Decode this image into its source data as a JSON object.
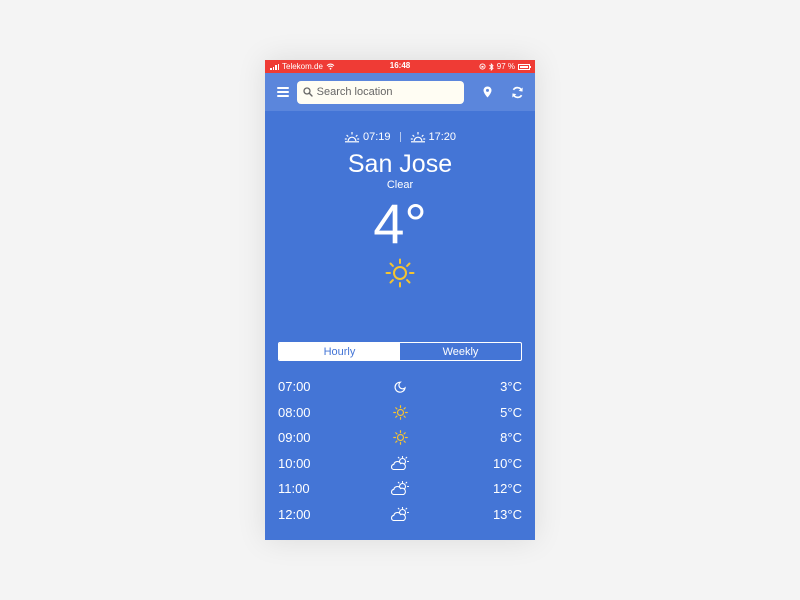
{
  "status_bar": {
    "carrier": "Telekom.de",
    "time": "16:48",
    "battery": "97 %",
    "battery_level": 0.97
  },
  "search": {
    "placeholder": "Search location"
  },
  "weather": {
    "sunrise": "07:19",
    "sunset": "17:20",
    "city": "San Jose",
    "condition": "Clear",
    "temperature": "4°",
    "icon": "sun-icon"
  },
  "tabs": [
    {
      "label": "Hourly",
      "active": true
    },
    {
      "label": "Weekly",
      "active": false
    }
  ],
  "hourly": [
    {
      "time": "07:00",
      "icon": "moon-icon",
      "temp": "3°C"
    },
    {
      "time": "08:00",
      "icon": "sun-icon",
      "temp": "5°C"
    },
    {
      "time": "09:00",
      "icon": "sun-icon",
      "temp": "8°C"
    },
    {
      "time": "10:00",
      "icon": "partly-cloudy-icon",
      "temp": "10°C"
    },
    {
      "time": "11:00",
      "icon": "partly-cloudy-icon",
      "temp": "12°C"
    },
    {
      "time": "12:00",
      "icon": "partly-cloudy-icon",
      "temp": "13°C"
    }
  ],
  "colors": {
    "background": "#4475d6",
    "navbar": "#5b86dc",
    "status_bar": "#ef3b35",
    "sun": "#f5c431"
  }
}
